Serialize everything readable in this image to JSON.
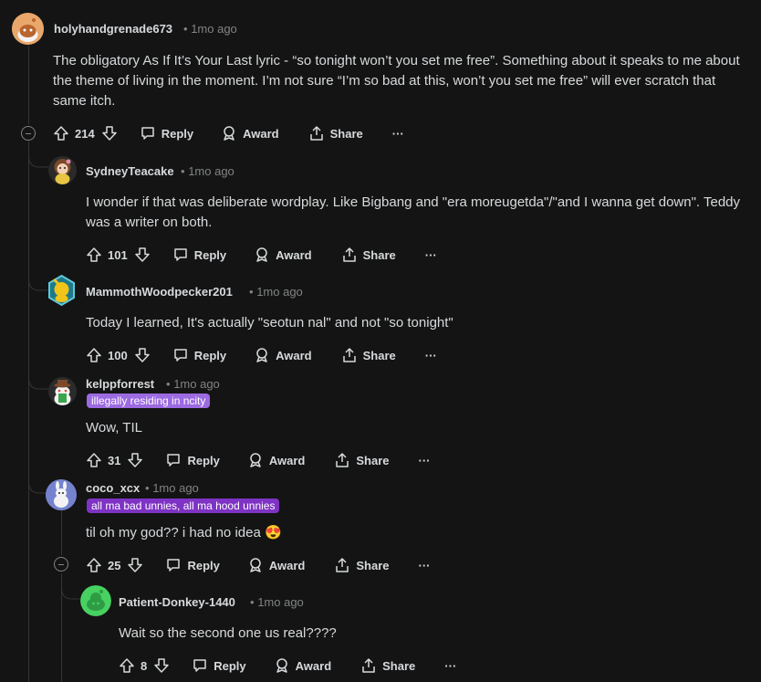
{
  "comments": [
    {
      "username": "holyhandgrenade673",
      "time": "1mo ago",
      "body": "The obligatory As If It’s Your Last lyric - “so tonight won’t you set me free”. Something about it speaks to me about the theme of living in the moment. I’m not sure “I’m so bad at this, won’t you set me free” will ever scratch that same itch.",
      "score": "214",
      "reply": "Reply",
      "award": "Award",
      "share": "Share",
      "more": "···"
    },
    {
      "username": "SydneyTeacake",
      "time": "1mo ago",
      "body": "I wonder if that was deliberate wordplay. Like Bigbang and \"era moreugetda\"/\"and I wanna get down\". Teddy was a writer on both.",
      "score": "101",
      "reply": "Reply",
      "award": "Award",
      "share": "Share",
      "more": "···"
    },
    {
      "username": "MammothWoodpecker201",
      "time": "1mo ago",
      "body": "Today I learned, It's actually \"seotun nal\" and not \"so tonight\"",
      "score": "100",
      "reply": "Reply",
      "award": "Award",
      "share": "Share",
      "more": "···"
    },
    {
      "username": "kelppforrest",
      "time": "1mo ago",
      "flair": "illegally residing in ncity",
      "body": "Wow, TIL",
      "score": "31",
      "reply": "Reply",
      "award": "Award",
      "share": "Share",
      "more": "···"
    },
    {
      "username": "coco_xcx",
      "time": "1mo ago",
      "flair": "all ma bad unnies, all ma hood unnies",
      "body": "til oh my god?? i had no idea 😍",
      "score": "25",
      "reply": "Reply",
      "award": "Award",
      "share": "Share",
      "more": "···"
    },
    {
      "username": "Patient-Donkey-1440",
      "time": "1mo ago",
      "body": "Wait so the second one us real????",
      "score": "8",
      "reply": "Reply",
      "award": "Award",
      "share": "Share",
      "more": "···"
    }
  ],
  "separator": "•",
  "colors": {
    "background": "#141414",
    "text": "#d7dadc",
    "meta": "#818384",
    "thread_line": "#343536",
    "flair_light_purple": "#9c6ae1",
    "flair_dark_purple": "#7e33c4"
  }
}
